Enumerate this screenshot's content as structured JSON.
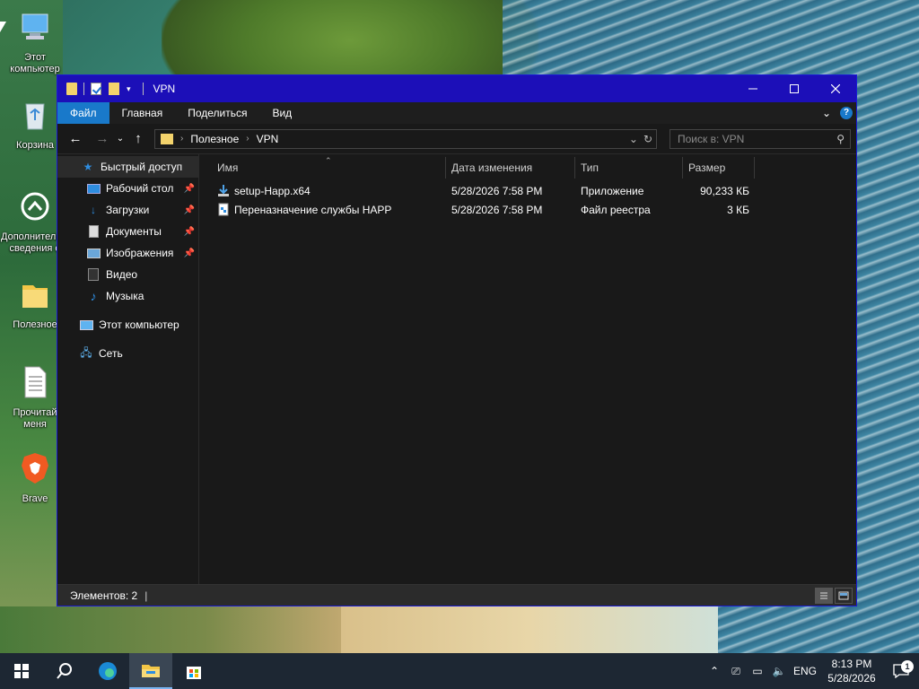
{
  "desktop": {
    "icons": [
      {
        "label": "Этот компьютер",
        "icon": "this-pc-icon"
      },
      {
        "label": "Корзина",
        "icon": "recycle-bin-icon"
      },
      {
        "label": "Дополнительные сведения о",
        "icon": "info-icon"
      },
      {
        "label": "Полезное",
        "icon": "folder-icon"
      },
      {
        "label": "Прочитай меня",
        "icon": "text-file-icon"
      },
      {
        "label": "Brave",
        "icon": "brave-icon"
      }
    ]
  },
  "window": {
    "title": "VPN",
    "ribbon": {
      "tabs": [
        "Файл",
        "Главная",
        "Поделиться",
        "Вид"
      ],
      "help_label": "?"
    },
    "address": {
      "crumbs": [
        "Полезное",
        "VPN"
      ]
    },
    "search": {
      "placeholder": "Поиск в: VPN"
    },
    "nav": {
      "quick_access": "Быстрый доступ",
      "quick_items": [
        {
          "label": "Рабочий стол",
          "pinned": true
        },
        {
          "label": "Загрузки",
          "pinned": true
        },
        {
          "label": "Документы",
          "pinned": true
        },
        {
          "label": "Изображения",
          "pinned": true
        },
        {
          "label": "Видео",
          "pinned": false
        },
        {
          "label": "Музыка",
          "pinned": false
        }
      ],
      "this_pc": "Этот компьютер",
      "network": "Сеть"
    },
    "columns": {
      "name": "Имя",
      "date": "Дата изменения",
      "type": "Тип",
      "size": "Размер"
    },
    "files": [
      {
        "name": "setup-Happ.x64",
        "date": "5/28/2026 7:58 PM",
        "type": "Приложение",
        "size": "90,233 КБ",
        "icon": "installer-icon"
      },
      {
        "name": "Переназначение службы HAPP",
        "date": "5/28/2026 7:58 PM",
        "type": "Файл реестра",
        "size": "3 КБ",
        "icon": "registry-file-icon"
      }
    ],
    "status": {
      "items_count": "Элементов: 2"
    }
  },
  "taskbar": {
    "language": "ENG",
    "time": "8:13 PM",
    "date": "5/28/2026",
    "notification_count": "1"
  },
  "colors": {
    "titlebar": "#1c0fb8",
    "file_tab": "#1979ca",
    "window_bg": "#191919",
    "taskbar": "#1d2733"
  }
}
